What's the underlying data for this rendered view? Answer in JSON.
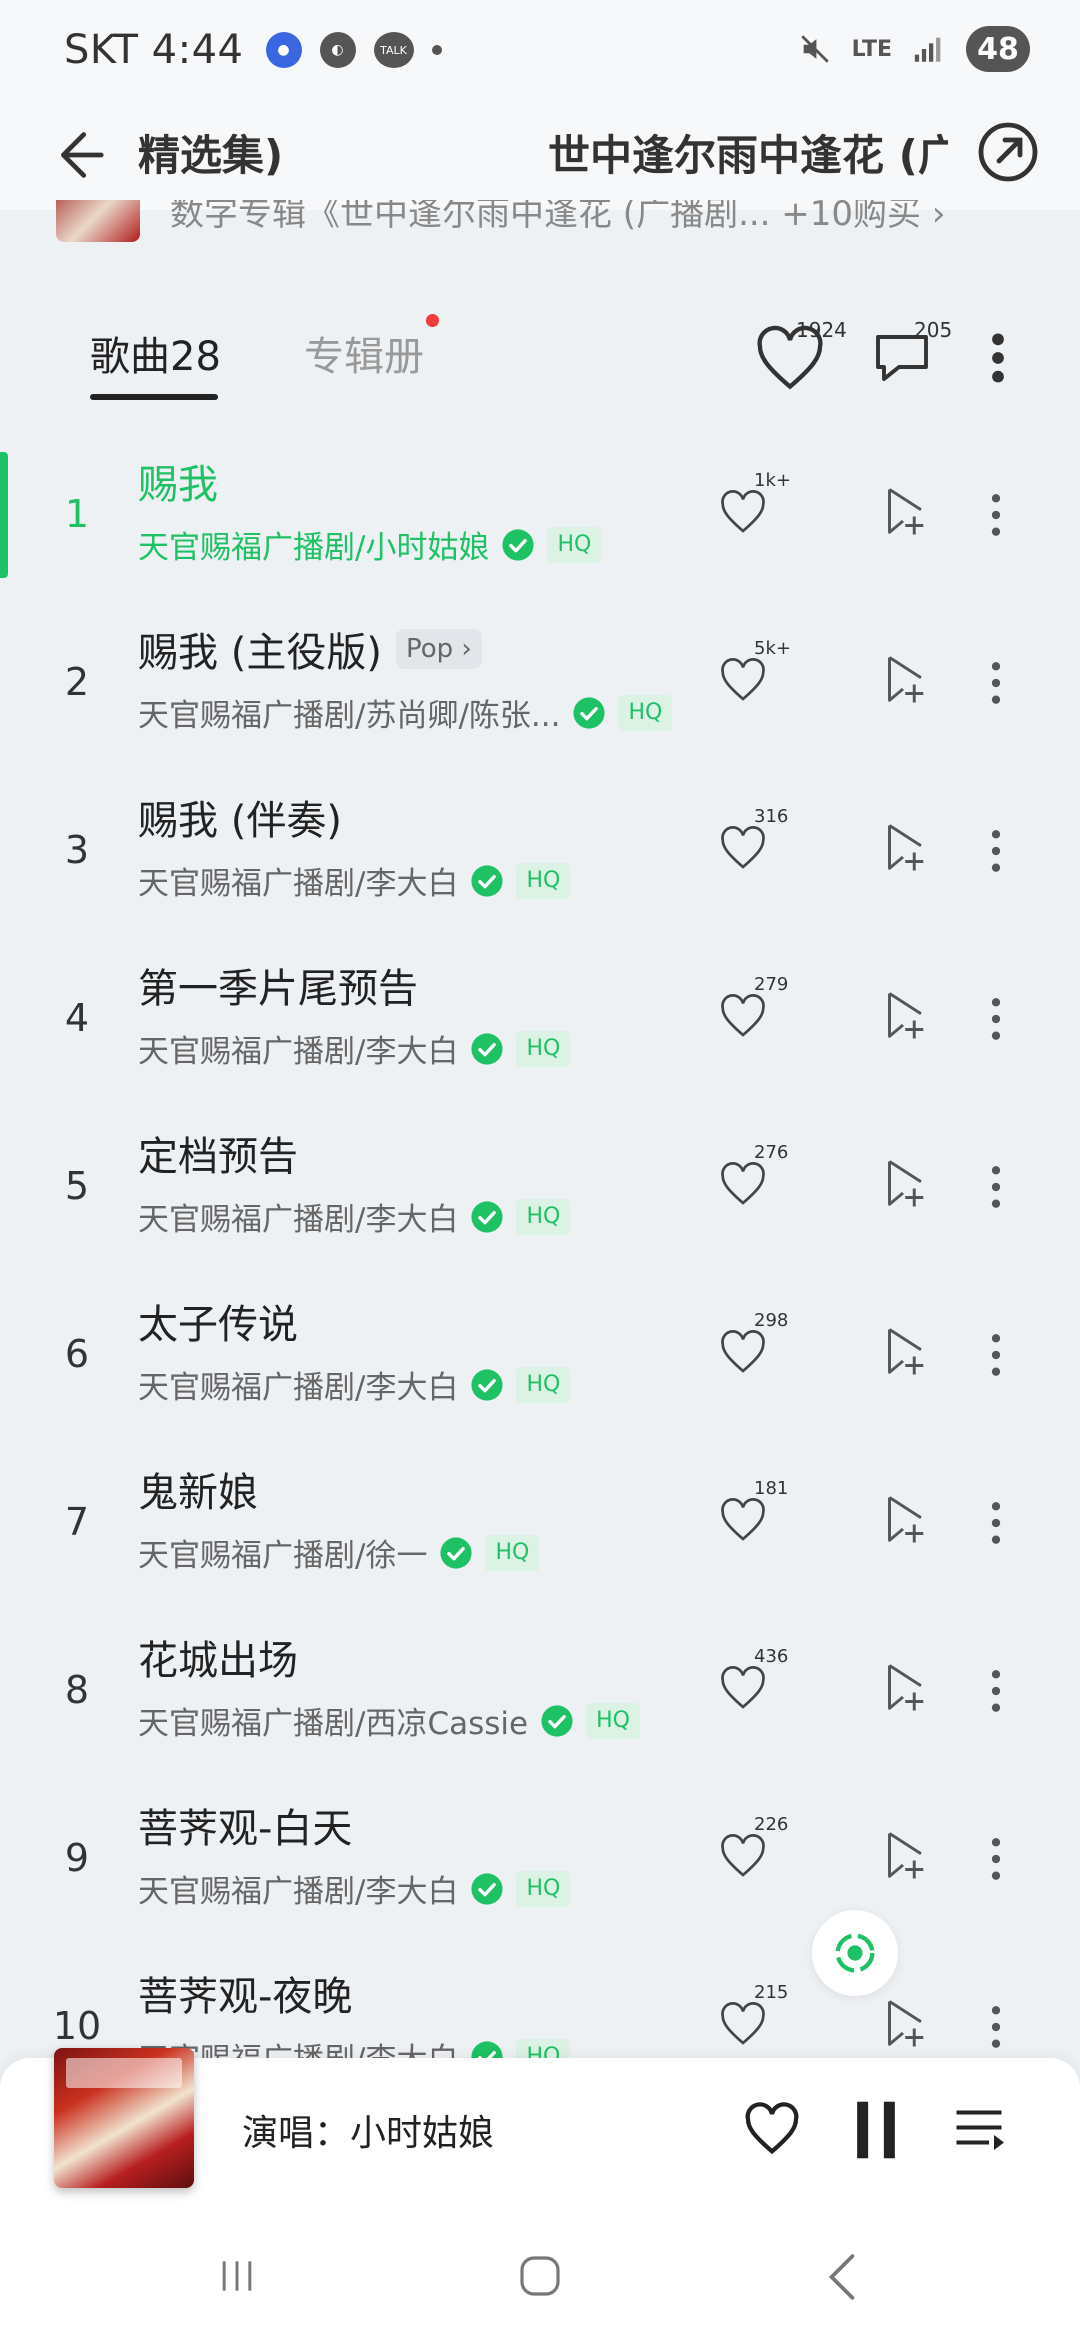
{
  "status_bar": {
    "carrier_time": "SKT 4:44",
    "network": "LTE",
    "battery": "48"
  },
  "header": {
    "left_title": "精选集)",
    "mid_title": "世中逢尔雨中逢花 (广"
  },
  "album_strip": {
    "text": "数字专辑《世中逢尔雨中逢花 (广播剧...   +10购买 ›"
  },
  "tabs": {
    "songs": "歌曲28",
    "album": "专辑册",
    "likes_count": "1924",
    "comments_count": "205"
  },
  "songs": [
    {
      "index": "1",
      "title": "赐我",
      "artist": "天官赐福广播剧/小时姑娘",
      "likes": "1k+",
      "hq": "HQ",
      "genre": "",
      "active": true
    },
    {
      "index": "2",
      "title": "赐我 (主役版)",
      "artist": "天官赐福广播剧/苏尚卿/陈张...",
      "likes": "5k+",
      "hq": "HQ",
      "genre": "Pop ›",
      "active": false
    },
    {
      "index": "3",
      "title": "赐我 (伴奏)",
      "artist": "天官赐福广播剧/李大白",
      "likes": "316",
      "hq": "HQ",
      "genre": "",
      "active": false
    },
    {
      "index": "4",
      "title": "第一季片尾预告",
      "artist": "天官赐福广播剧/李大白",
      "likes": "279",
      "hq": "HQ",
      "genre": "",
      "active": false
    },
    {
      "index": "5",
      "title": "定档预告",
      "artist": "天官赐福广播剧/李大白",
      "likes": "276",
      "hq": "HQ",
      "genre": "",
      "active": false
    },
    {
      "index": "6",
      "title": "太子传说",
      "artist": "天官赐福广播剧/李大白",
      "likes": "298",
      "hq": "HQ",
      "genre": "",
      "active": false
    },
    {
      "index": "7",
      "title": "鬼新娘",
      "artist": "天官赐福广播剧/徐一",
      "likes": "181",
      "hq": "HQ",
      "genre": "",
      "active": false
    },
    {
      "index": "8",
      "title": "花城出场",
      "artist": "天官赐福广播剧/西凉Cassie",
      "likes": "436",
      "hq": "HQ",
      "genre": "",
      "active": false
    },
    {
      "index": "9",
      "title": "菩荠观-白天",
      "artist": "天官赐福广播剧/李大白",
      "likes": "226",
      "hq": "HQ",
      "genre": "",
      "active": false
    },
    {
      "index": "10",
      "title": "菩荠观-夜晚",
      "artist": "天官赐福广播剧/李大白",
      "likes": "215",
      "hq": "HQ",
      "genre": "",
      "active": false
    }
  ],
  "player": {
    "singer": "演唱：小时姑娘"
  },
  "colors": {
    "accent": "#1ec265",
    "background": "#eef1f4",
    "badge_red": "#f03c3c"
  }
}
